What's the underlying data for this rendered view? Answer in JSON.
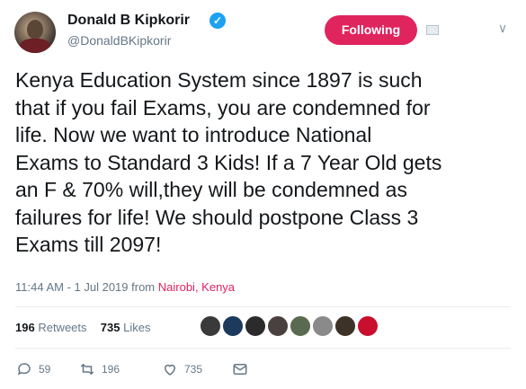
{
  "user": {
    "display_name": "Donald B Kipkorir",
    "handle": "@DonaldBKipkorir",
    "verified_icon": "verified-badge-icon"
  },
  "header": {
    "follow_button_label": "Following",
    "colors": {
      "accent": "#e0245e",
      "verified": "#1da1f2"
    }
  },
  "tweet": {
    "text": "Kenya Education System since 1897 is such\nthat if you fail Exams, you are condemned for\nlife. Now we want to introduce National\nExams to Standard 3 Kids! If a 7 Year Old gets\nan F & 70% will,they will be condemned as\nfailures for life! We should postpone Class 3\nExams till 2097!",
    "timestamp": "11:44 AM - 1 Jul 2019",
    "from_label": "from",
    "location": "Nairobi, Kenya"
  },
  "stats": {
    "retweets_count": "196",
    "retweets_label": "Retweets",
    "likes_count": "735",
    "likes_label": "Likes",
    "liker_avatar_colors": [
      "#3a3a3a",
      "#1b3a5c",
      "#2b2b2b",
      "#4a4040",
      "#5a6a50",
      "#8a8a8a",
      "#3c3228",
      "#c8102e"
    ]
  },
  "actions": {
    "reply_count": "59",
    "retweet_count": "196",
    "like_count": "735"
  }
}
